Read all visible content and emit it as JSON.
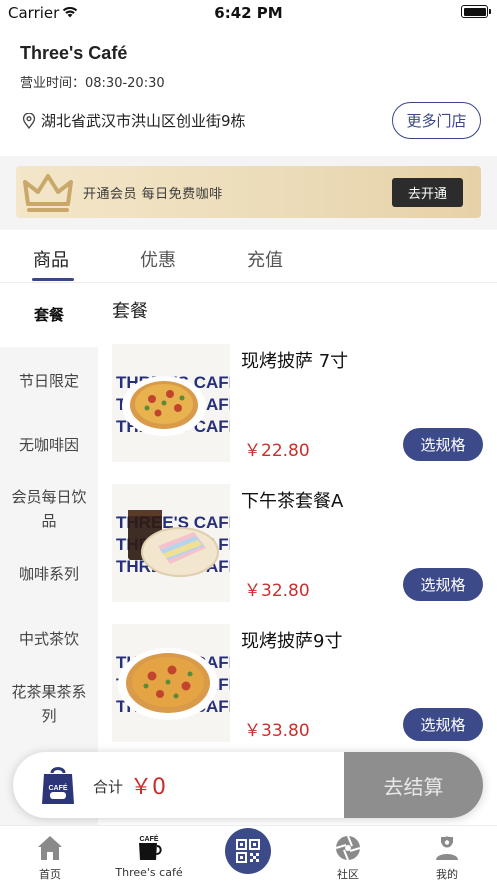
{
  "status_bar": {
    "carrier": "Carrier",
    "time": "6:42 PM"
  },
  "shop": {
    "name": "Three's Café",
    "hours": "营业时间：08:30-20:30",
    "address": "湖北省武汉市洪山区创业街9栋",
    "more_stores_label": "更多门店"
  },
  "membership_banner": {
    "text": "开通会员  每日免费咖啡",
    "button_label": "去开通",
    "icon": "crown-icon"
  },
  "tabs": [
    {
      "label": "商品",
      "active": true
    },
    {
      "label": "优惠",
      "active": false
    },
    {
      "label": "充值",
      "active": false
    }
  ],
  "categories": [
    {
      "label": "套餐",
      "active": true
    },
    {
      "label": "节日限定"
    },
    {
      "label": "无咖啡因"
    },
    {
      "label": "会员每日饮品"
    },
    {
      "label": "咖啡系列"
    },
    {
      "label": "中式茶饮"
    },
    {
      "label": "花茶果茶系列"
    }
  ],
  "current_category_title": "套餐",
  "products": [
    {
      "name": "现烤披萨 7寸",
      "price": "￥22.80",
      "button_label": "选规格",
      "image": "pizza"
    },
    {
      "name": "下午茶套餐A",
      "price": "￥32.80",
      "button_label": "选规格",
      "image": "coffee-and-cake"
    },
    {
      "name": "现烤披萨9寸",
      "price": "￥33.80",
      "button_label": "选规格",
      "image": "pizza"
    }
  ],
  "image_watermark": "THREE'S CAFÉ",
  "cart": {
    "total_label": "合计",
    "total_value": "￥0",
    "checkout_label": "去结算",
    "bag_text": "CAFÉ"
  },
  "tabbar": [
    {
      "label": "首页",
      "icon": "home-icon"
    },
    {
      "label": "Three's café",
      "icon": "cafe-logo-icon",
      "logo_text": "CAFÉ"
    },
    {
      "label": "",
      "icon": "qr-code-icon"
    },
    {
      "label": "社区",
      "icon": "aperture-icon"
    },
    {
      "label": "我的",
      "icon": "user-icon"
    }
  ],
  "colors": {
    "brand": "#3d4a8a",
    "price": "#c8302f",
    "checkout_bg": "#8e8e8e",
    "banner_gold": "#ecdcb9"
  }
}
